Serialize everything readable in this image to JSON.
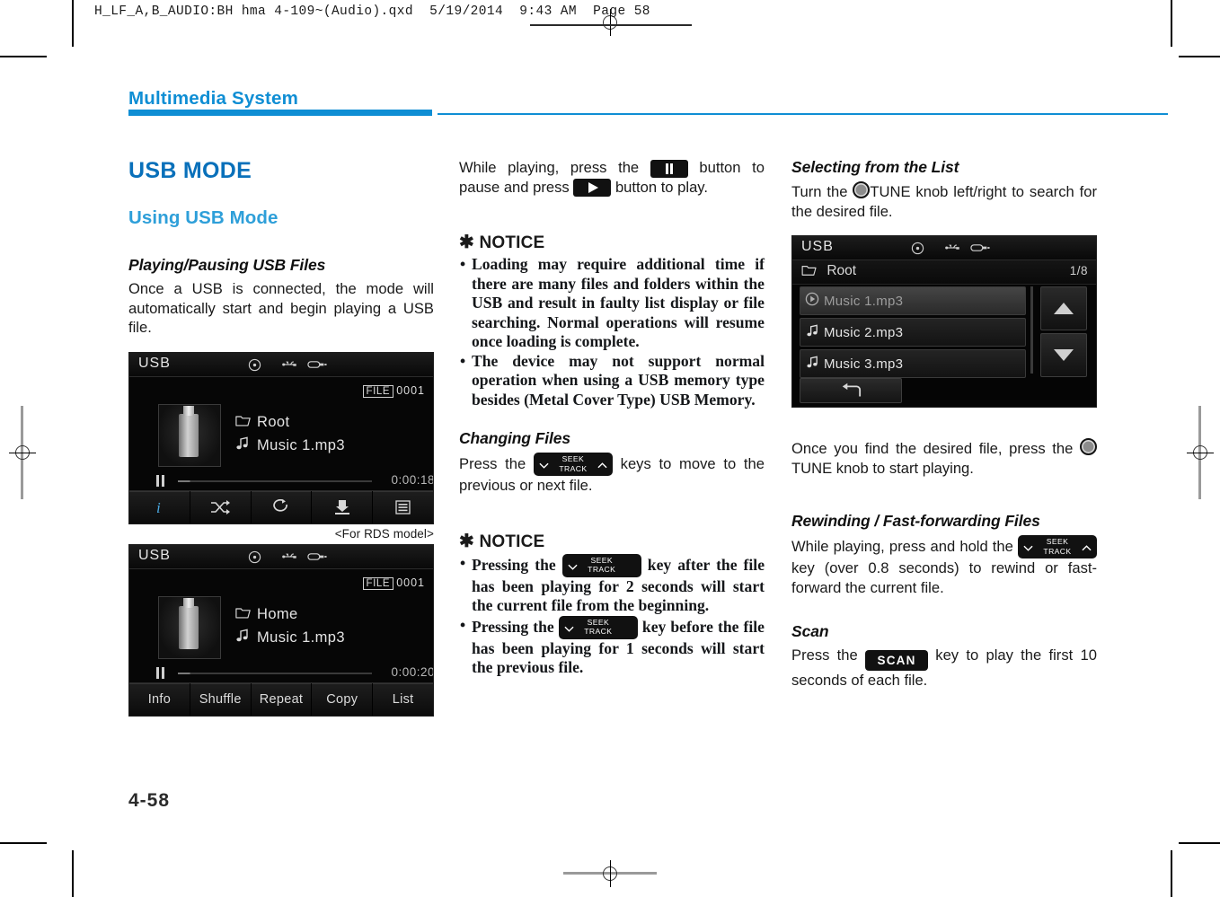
{
  "prepress": {
    "file_header": "H_LF_A,B_AUDIO:BH hma 4-109~(Audio).qxd  5/19/2014  9:43 AM  Page 58"
  },
  "page": {
    "chapter_title": "Multimedia System",
    "page_number": "4-58",
    "accent_blue": "#0f8ed4",
    "heading_blue": "#0970ba",
    "subheading_blue": "#2e9fd9"
  },
  "col1": {
    "section_title": "USB MODE",
    "sub_title": "Using USB Mode",
    "head_playing": "Playing/Pausing USB Files",
    "para_playing": "Once a USB is connected, the mode will automatically start and begin playing a USB file.",
    "caption_rds": "<For RDS model>",
    "shot_a": {
      "source": "USB",
      "file_label": "FILE",
      "file_number": "0001",
      "folder": "Root",
      "track": "Music 1.mp3",
      "time": "0:00:18",
      "buttons": [
        "info-icon",
        "shuffle-icon",
        "repeat-icon",
        "copy-icon",
        "list-icon"
      ]
    },
    "shot_b": {
      "source": "USB",
      "file_label": "FILE",
      "file_number": "0001",
      "folder": "Home",
      "track": "Music 1.mp3",
      "time": "0:00:20",
      "buttons": [
        "Info",
        "Shuffle",
        "Repeat",
        "Copy",
        "List"
      ]
    }
  },
  "col2": {
    "para_pause_pre": "While playing, press the",
    "para_pause_mid": "button to pause and press",
    "para_pause_post": "button to play.",
    "notice_title": "NOTICE",
    "notice_items": [
      "Loading may require additional time if there are many files and folders within the USB and result in faulty list display or file searching. Normal operations will resume once loading is complete.",
      "The device may not support normal operation when using a USB memory type besides (Metal Cover Type) USB Memory."
    ],
    "head_changing": "Changing Files",
    "para_changing_pre": "Press the",
    "para_changing_post": "keys to move to the previous or next file.",
    "notice2_title": "NOTICE",
    "notice2_a_pre": "Pressing the",
    "notice2_a_post": "key after the file has been playing for 2 seconds will start the current file from the beginning.",
    "notice2_b_pre": "Pressing the",
    "notice2_b_post": "key before the file has been playing for 1 seconds will start the previous file.",
    "seek_top": "SEEK",
    "seek_bottom": "TRACK"
  },
  "col3": {
    "head_selecting": "Selecting from the List",
    "para_selecting_pre": "Turn the",
    "para_selecting_post": "TUNE knob left/right to search for the desired file.",
    "shot_list": {
      "source": "USB",
      "folder": "Root",
      "page_count": "1/8",
      "rows": [
        "Music 1.mp3",
        "Music 2.mp3",
        "Music 3.mp3"
      ]
    },
    "para_found_pre": "Once you find the desired file, press the",
    "para_found_post": "TUNE knob to start playing.",
    "head_rewinding": "Rewinding / Fast-forwarding Files",
    "para_rewinding_pre": "While playing, press and hold the",
    "para_rewinding_post": "key (over 0.8 seconds) to rewind or fast-forward the current file.",
    "head_scan": "Scan",
    "para_scan_pre": "Press the",
    "scan_label": "SCAN",
    "para_scan_post": "key to play the first 10 seconds of each file."
  }
}
